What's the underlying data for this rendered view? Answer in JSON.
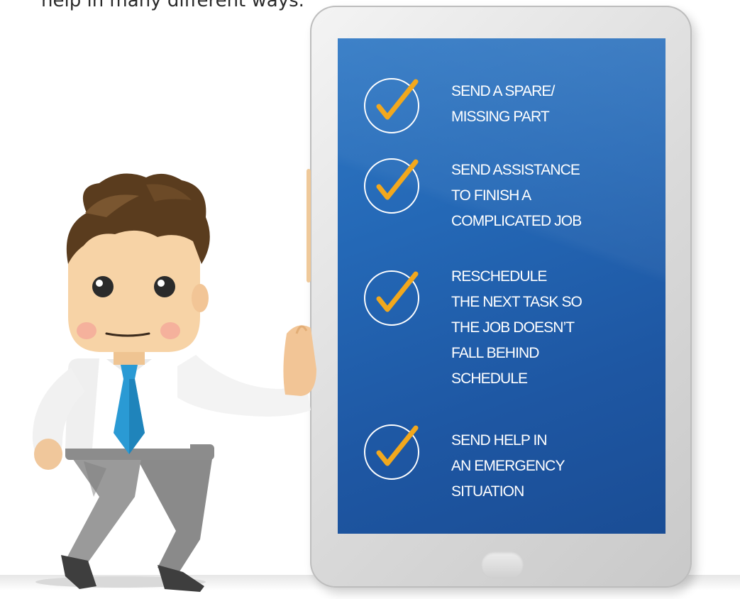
{
  "intro": {
    "text": "help in many different ways."
  },
  "checklist": {
    "items": [
      {
        "lines": [
          "SEND A SPARE/",
          "MISSING PART"
        ]
      },
      {
        "lines": [
          "SEND ASSISTANCE",
          "TO FINISH A",
          "COMPLICATED JOB"
        ]
      },
      {
        "lines": [
          "RESCHEDULE",
          "THE NEXT TASK SO",
          "THE JOB DOESN’T",
          "FALL BEHIND",
          "SCHEDULE"
        ]
      },
      {
        "lines": [
          "SEND HELP IN",
          "AN EMERGENCY",
          "SITUATION"
        ]
      }
    ]
  },
  "colors": {
    "screen_blue": "#2468b6",
    "check_orange": "#f2a81d",
    "tie_blue": "#2a9ad4",
    "skin": "#f7d3a6",
    "hair": "#5a3c1e"
  },
  "icons": {
    "check": "checkmark-icon"
  }
}
